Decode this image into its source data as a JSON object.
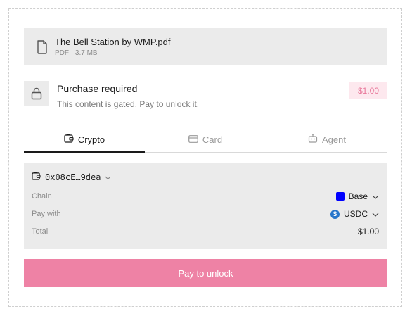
{
  "file": {
    "name": "The Bell Station by WMP.pdf",
    "meta": "PDF · 3.7 MB",
    "icon": "file-icon"
  },
  "purchase": {
    "title": "Purchase required",
    "subtitle": "This content is gated. Pay to unlock it.",
    "price": "$1.00",
    "icon": "lock-icon"
  },
  "tabs": [
    {
      "label": "Crypto",
      "icon": "wallet-icon",
      "active": true
    },
    {
      "label": "Card",
      "icon": "credit-card-icon",
      "active": false
    },
    {
      "label": "Agent",
      "icon": "robot-icon",
      "active": false
    }
  ],
  "payment": {
    "wallet_address": "0x08cE…9dea",
    "chain_label": "Chain",
    "chain_value": "Base",
    "pay_with_label": "Pay with",
    "pay_with_value": "USDC",
    "total_label": "Total",
    "total_value": "$1.00"
  },
  "action": {
    "pay_label": "Pay to unlock"
  },
  "colors": {
    "accent": "#ee82a5",
    "price_badge_bg": "#fde8ee",
    "price_badge_text": "#e8799b",
    "base_chain": "#0000ff",
    "usdc": "#2775ca"
  }
}
